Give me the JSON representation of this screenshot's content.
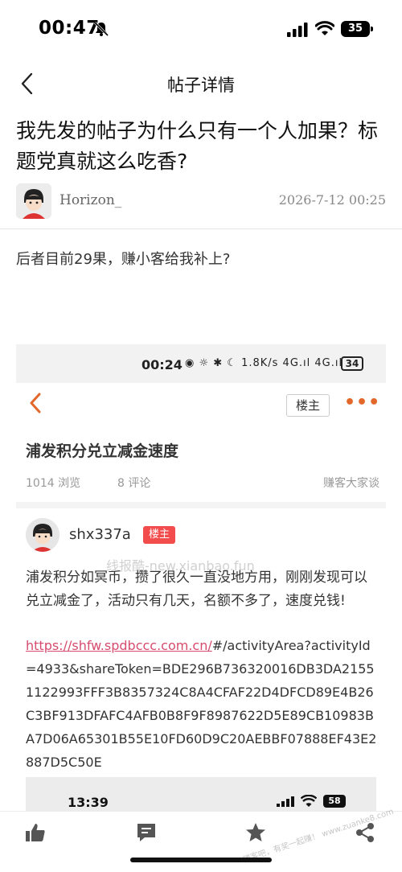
{
  "status_bar": {
    "time": "00:47",
    "battery": "35"
  },
  "nav": {
    "title": "帖子详情"
  },
  "post": {
    "title": "我先发的帖子为什么只有一个人加果？标题党真就这么吃香?",
    "author": "Horizon_",
    "time": "2026-7-12 00:25",
    "body": "后者目前29果，赚小客给我补上?"
  },
  "embedded": {
    "status_time": "00:24",
    "status_icons": "◉ ☼ ✱ ☾ 1.8K/s 4G.ıl 4G.ıl",
    "battery": "34",
    "owner_button": "楼主",
    "more": "•••",
    "title": "浦发积分兑立减金速度",
    "views": "1014 浏览",
    "comments": "8 评论",
    "forum": "赚客大家谈",
    "username": "shx337a",
    "badge": "楼主",
    "watermark": "线报酷-new.xianbao.fun",
    "text": "浦发积分如冥币，攒了很久一直没地方用，刚刚发现可以兑立减金了，活动只有几天，名额不多了，速度兑钱!",
    "link_underlined": "https://shfw.spdbccc.com.cn/",
    "link_rest": "#/activityArea?activityId=4933&shareToken=BDE296B736320016DB3DA21551122993FFF3B8357324C8A4CFAF22D4DFCD89E4B26C3BF913DFAFC4AFB0B8F9F8987622D5E89CB10983BA7D06A65301B55E10FD60D9C20AEBBF07888EF43E2887D5C50E",
    "inner_time": "13:39",
    "inner_battery": "58"
  },
  "corner_watermark": "赚客吧，有奖一起赚！ www.zuanke8.com",
  "colors": {
    "accent": "#e2672a",
    "badge": "#f24c4c",
    "link": "#d64b6e"
  }
}
